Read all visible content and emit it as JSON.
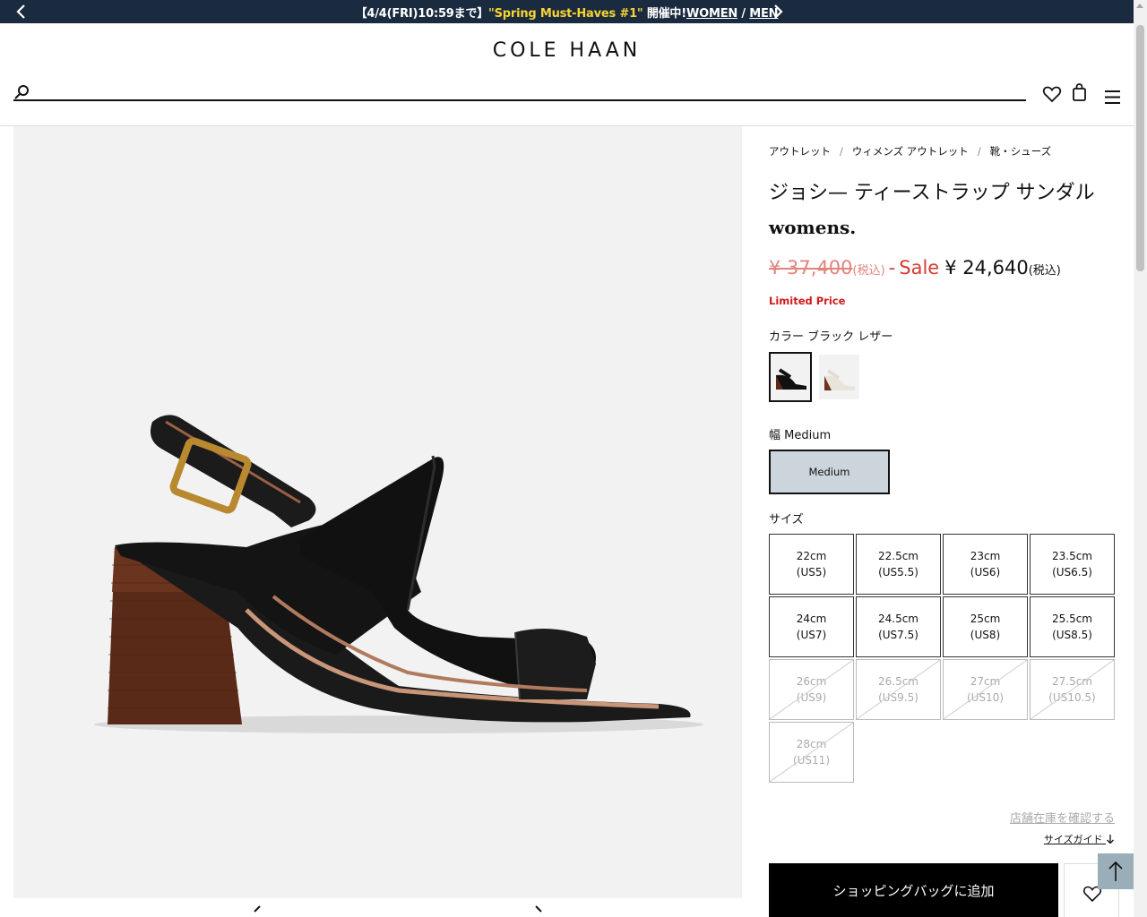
{
  "promo": {
    "prefix": "【4/4(FRI)10:59まで】",
    "highlight": "\"Spring Must-Haves #1\"",
    "middle": " 開催中!",
    "women": "WOMEN",
    "slash": " / ",
    "men": "MEN"
  },
  "header": {
    "logo": "COLE HAAN",
    "search_placeholder": ""
  },
  "breadcrumbs": [
    "アウトレット",
    "ウィメンズ アウトレット",
    "靴・シューズ"
  ],
  "breadcrumb_sep": "/",
  "product": {
    "title_line1": "ジョシ— ティーストラップ サンダル",
    "title_line2": "womens.",
    "original_price": "¥ 37,400",
    "original_tax": "(税込)",
    "dash": "-",
    "sale_label": "Sale",
    "sale_price": "¥ 24,640",
    "sale_tax": "(税込)",
    "limited": "Limited Price",
    "color_label": "カラー ブラック レザー",
    "width_label": "幅 Medium",
    "width_option": "Medium",
    "size_label": "サイズ",
    "sizes": [
      {
        "cm": "22cm",
        "us": "(US5)",
        "available": true
      },
      {
        "cm": "22.5cm",
        "us": "(US5.5)",
        "available": true
      },
      {
        "cm": "23cm",
        "us": "(US6)",
        "available": true
      },
      {
        "cm": "23.5cm",
        "us": "(US6.5)",
        "available": true
      },
      {
        "cm": "24cm",
        "us": "(US7)",
        "available": true
      },
      {
        "cm": "24.5cm",
        "us": "(US7.5)",
        "available": true
      },
      {
        "cm": "25cm",
        "us": "(US8)",
        "available": true
      },
      {
        "cm": "25.5cm",
        "us": "(US8.5)",
        "available": true
      },
      {
        "cm": "26cm",
        "us": "(US9)",
        "available": false
      },
      {
        "cm": "26.5cm",
        "us": "(US9.5)",
        "available": false
      },
      {
        "cm": "27cm",
        "us": "(US10)",
        "available": false
      },
      {
        "cm": "27.5cm",
        "us": "(US10.5)",
        "available": false
      },
      {
        "cm": "28cm",
        "us": "(US11)",
        "available": false
      }
    ],
    "store_stock_link": "店舗在庫を確認する",
    "size_guide": "サイズガイド",
    "add_to_bag": "ショッピングバッグに追加"
  },
  "icons": {
    "search": "search-icon",
    "wishlist": "heart-icon",
    "bag": "shopping-bag-icon",
    "menu": "hamburger-menu-icon",
    "prev": "chevron-left-icon",
    "next": "chevron-right-icon",
    "back_to_top": "arrow-up-icon"
  },
  "colors": {
    "promo_bg": "#1a2a3f",
    "promo_highlight": "#f7d431",
    "sale_red": "#d63b2f",
    "limited_red": "#d0191b",
    "width_selected_bg": "#ccd5dc",
    "back_to_top_bg": "#9aaeba"
  }
}
